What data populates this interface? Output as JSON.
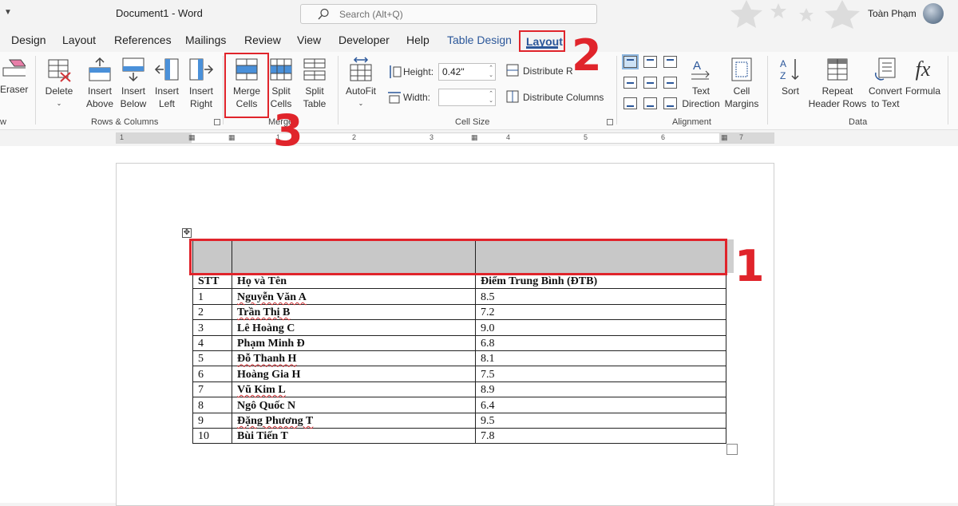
{
  "titlebar": {
    "document_title": "Document1  -  Word",
    "search_placeholder": "Search (Alt+Q)",
    "user_name": "Toàn Phạm"
  },
  "tabs": [
    {
      "label": "Design"
    },
    {
      "label": "Layout"
    },
    {
      "label": "References"
    },
    {
      "label": "Mailings"
    },
    {
      "label": "Review"
    },
    {
      "label": "View"
    },
    {
      "label": "Developer"
    },
    {
      "label": "Help"
    },
    {
      "label": "Table Design"
    },
    {
      "label": "Layout",
      "active": true
    }
  ],
  "ribbon": {
    "draw": {
      "eraser": "Eraser",
      "group_label_fragment": "w"
    },
    "rows_columns": {
      "delete": "Delete",
      "insert_above": [
        "Insert",
        "Above"
      ],
      "insert_below": [
        "Insert",
        "Below"
      ],
      "insert_left": [
        "Insert",
        "Left"
      ],
      "insert_right": [
        "Insert",
        "Right"
      ],
      "group_label": "Rows & Columns"
    },
    "merge": {
      "merge_cells": [
        "Merge",
        "Cells"
      ],
      "split_cells": [
        "Split",
        "Cells"
      ],
      "split_table": [
        "Split",
        "Table"
      ],
      "group_label": "Merge"
    },
    "cell_size": {
      "autofit": "AutoFit",
      "height_label": "Height:",
      "height_value": "0.42\"",
      "width_label": "Width:",
      "width_value": "",
      "distribute_rows": "Distribute R",
      "distribute_columns": "Distribute Columns",
      "group_label": "Cell Size"
    },
    "alignment": {
      "text_direction": [
        "Text",
        "Direction"
      ],
      "cell_margins": [
        "Cell",
        "Margins"
      ],
      "group_label": "Alignment"
    },
    "data": {
      "sort": "Sort",
      "repeat_header_rows": [
        "Repeat",
        "Header Rows"
      ],
      "convert_to_text": [
        "Convert",
        "to Text"
      ],
      "formula": "Formula",
      "group_label": "Data"
    }
  },
  "ruler": {
    "labels": [
      "1",
      "1",
      "2",
      "3",
      "4",
      "5",
      "6",
      "7"
    ]
  },
  "table": {
    "headers": [
      "STT",
      "Họ và Tên",
      "Điểm Trung Bình (ĐTB)"
    ],
    "rows": [
      [
        "1",
        "Nguyễn Văn A",
        "8.5"
      ],
      [
        "2",
        "Trần Thị B",
        "7.2"
      ],
      [
        "3",
        "Lê Hoàng C",
        "9.0"
      ],
      [
        "4",
        "Phạm Minh Đ",
        "6.8"
      ],
      [
        "5",
        "Đỗ Thanh H",
        "8.1"
      ],
      [
        "6",
        "Hoàng Gia H",
        "7.5"
      ],
      [
        "7",
        "Vũ Kim L",
        "8.9"
      ],
      [
        "8",
        "Ngô Quốc N",
        "6.4"
      ],
      [
        "9",
        "Đặng Phương T",
        "9.5"
      ],
      [
        "10",
        "Bùi Tiến T",
        "7.8"
      ]
    ]
  },
  "annotations": {
    "step1": "1",
    "step2": "2",
    "step3": "3"
  },
  "colors": {
    "accent": "#2b579a",
    "highlight": "#e0242b",
    "selection": "#c8c8c8"
  }
}
